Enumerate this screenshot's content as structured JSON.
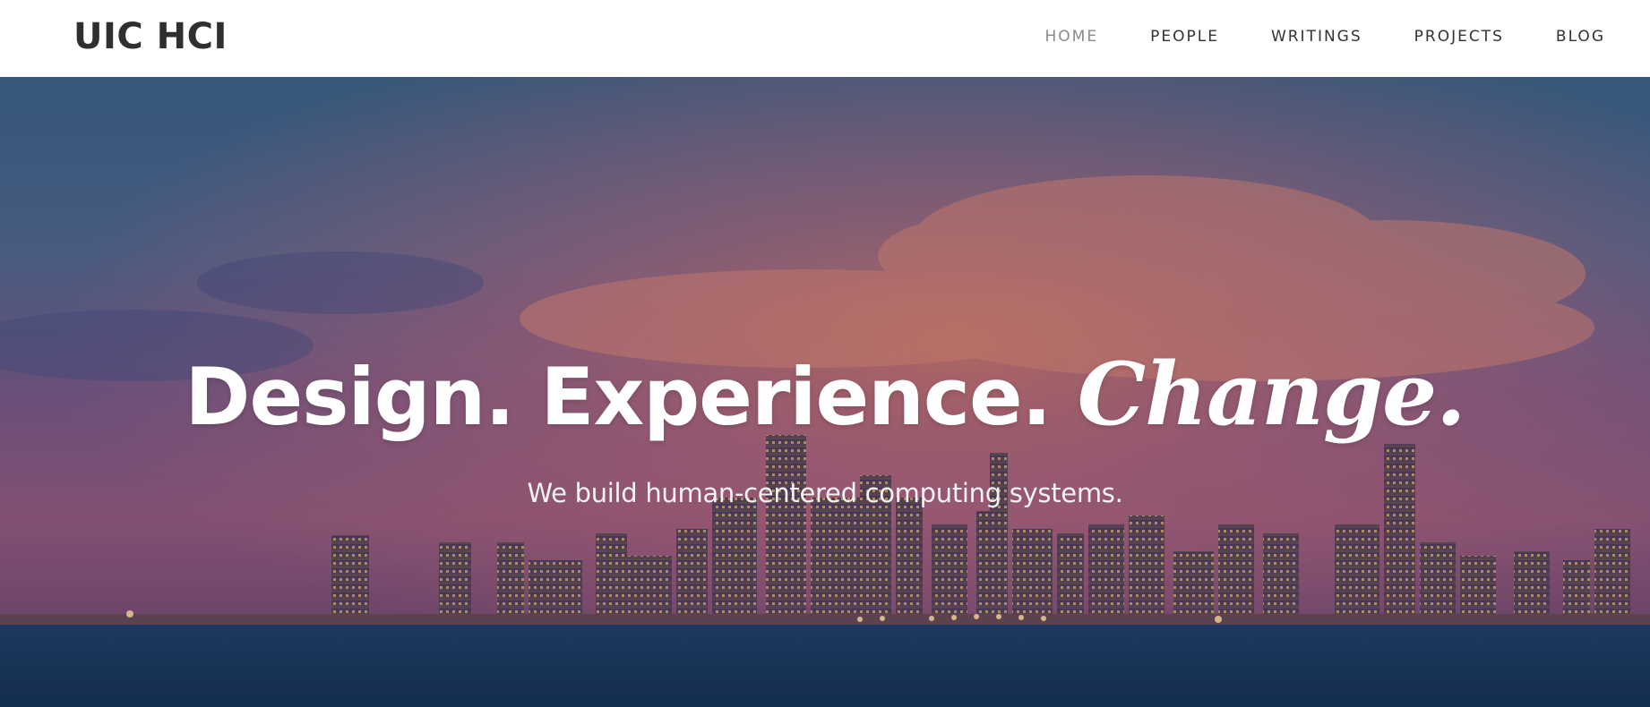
{
  "brand": {
    "title": "UIC HCI"
  },
  "nav": {
    "items": [
      {
        "label": "HOME"
      },
      {
        "label": "PEOPLE"
      },
      {
        "label": "WRITINGS"
      },
      {
        "label": "PROJECTS"
      },
      {
        "label": "BLOG"
      }
    ]
  },
  "hero": {
    "headline": "Design. Experience.",
    "headline_emphasis": "Change.",
    "subheadline": "We build human-centered computing systems.",
    "image": "chicago-skyline-at-dusk"
  },
  "colors": {
    "brand_text": "#2f2f2f",
    "nav_text": "#333333",
    "nav_active": "#8a8a8a",
    "hero_text": "#ffffff"
  }
}
